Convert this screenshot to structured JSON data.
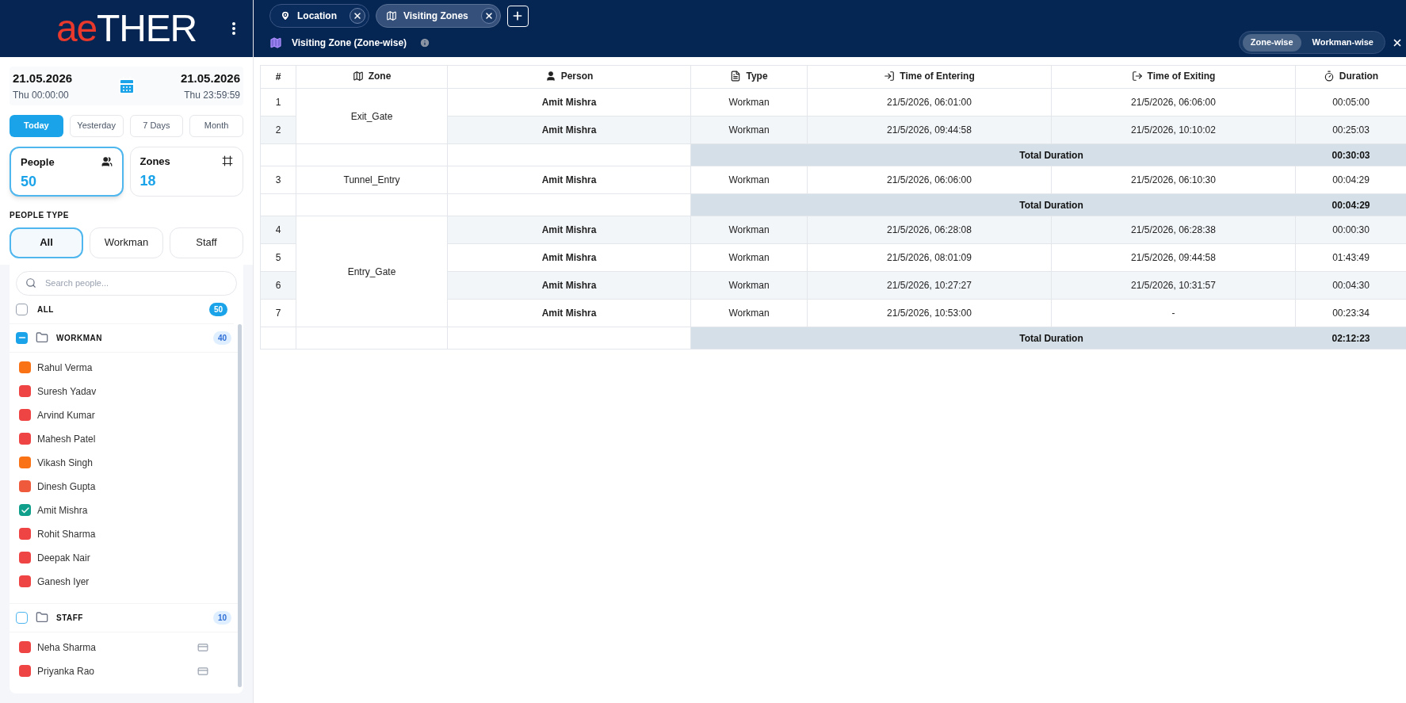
{
  "logo": {
    "accent": "ae",
    "rest": "THER"
  },
  "date_range": {
    "start_date": "21.05.2026",
    "start_time": "Thu 00:00:00",
    "end_date": "21.05.2026",
    "end_time": "Thu 23:59:59"
  },
  "range_buttons": [
    {
      "label": "Today",
      "selected": true
    },
    {
      "label": "Yesterday",
      "selected": false
    },
    {
      "label": "7 Days",
      "selected": false
    },
    {
      "label": "Month",
      "selected": false
    }
  ],
  "stat_cards": [
    {
      "kind": "people",
      "label": "People",
      "value": "50",
      "selected": true
    },
    {
      "kind": "zones",
      "label": "Zones",
      "value": "18",
      "selected": false
    }
  ],
  "people_type": {
    "title": "PEOPLE TYPE",
    "options": [
      {
        "label": "All",
        "selected": true
      },
      {
        "label": "Workman",
        "selected": false
      },
      {
        "label": "Staff",
        "selected": false
      }
    ]
  },
  "search": {
    "placeholder": "Search people..."
  },
  "all_row": {
    "label": "ALL",
    "count": "50",
    "checked": false
  },
  "groups": [
    {
      "label": "WORKMAN",
      "count": "40",
      "indeterminate": true,
      "people": [
        {
          "name": "Rahul Verma",
          "color": "#f97316",
          "checked": false,
          "kind": "plain"
        },
        {
          "name": "Suresh Yadav",
          "color": "#ef4444",
          "checked": false,
          "kind": "plain"
        },
        {
          "name": "Arvind Kumar",
          "color": "#ef4444",
          "checked": false,
          "kind": "plain"
        },
        {
          "name": "Mahesh Patel",
          "color": "#ef4444",
          "checked": false,
          "kind": "plain"
        },
        {
          "name": "Vikash Singh",
          "color": "#f97316",
          "checked": false,
          "kind": "plain"
        },
        {
          "name": "Dinesh Gupta",
          "color": "#f05a3c",
          "checked": false,
          "kind": "plain"
        },
        {
          "name": "Amit Mishra",
          "color": "#0f9f8a",
          "checked": true,
          "kind": "plain"
        },
        {
          "name": "Rohit Sharma",
          "color": "#ef4444",
          "checked": false,
          "kind": "plain"
        },
        {
          "name": "Deepak Nair",
          "color": "#ef4444",
          "checked": false,
          "kind": "plain"
        },
        {
          "name": "Ganesh Iyer",
          "color": "#ef4444",
          "checked": false,
          "kind": "plain"
        }
      ]
    },
    {
      "label": "STAFF",
      "count": "10",
      "indeterminate": false,
      "people": [
        {
          "name": "Neha Sharma",
          "color": "#ef4444",
          "checked": false,
          "kind": "card"
        },
        {
          "name": "Priyanka Rao",
          "color": "#ef4444",
          "checked": false,
          "kind": "card"
        }
      ]
    }
  ],
  "tabs": [
    {
      "label": "Location",
      "kind": "pin",
      "selected": false
    },
    {
      "label": "Visiting Zones",
      "kind": "map",
      "selected": true
    }
  ],
  "report_title": "Visiting Zone (Zone-wise)",
  "view_toggle": [
    {
      "label": "Zone-wise",
      "selected": true
    },
    {
      "label": "Workman-wise",
      "selected": false
    }
  ],
  "table": {
    "columns": [
      {
        "label": "#",
        "kind": "none"
      },
      {
        "label": "Zone",
        "kind": "map"
      },
      {
        "label": "Person",
        "kind": "user"
      },
      {
        "label": "Type",
        "kind": "doc"
      },
      {
        "label": "Time of Entering",
        "kind": "enter"
      },
      {
        "label": "Time of Exiting",
        "kind": "exit"
      },
      {
        "label": "Duration",
        "kind": "timer"
      }
    ],
    "groups": [
      {
        "zone": "Exit_Gate",
        "total_label": "Total Duration",
        "total": "00:30:03",
        "rows": [
          {
            "index": "1",
            "person": "Amit Mishra",
            "type": "Workman",
            "entered": "21/5/2026, 06:01:00",
            "exited": "21/5/2026, 06:06:00",
            "duration": "00:05:00"
          },
          {
            "index": "2",
            "person": "Amit Mishra",
            "type": "Workman",
            "entered": "21/5/2026, 09:44:58",
            "exited": "21/5/2026, 10:10:02",
            "duration": "00:25:03"
          }
        ]
      },
      {
        "zone": "Tunnel_Entry",
        "total_label": "Total Duration",
        "total": "00:04:29",
        "rows": [
          {
            "index": "3",
            "person": "Amit Mishra",
            "type": "Workman",
            "entered": "21/5/2026, 06:06:00",
            "exited": "21/5/2026, 06:10:30",
            "duration": "00:04:29"
          }
        ]
      },
      {
        "zone": "Entry_Gate",
        "total_label": "Total Duration",
        "total": "02:12:23",
        "rows": [
          {
            "index": "4",
            "person": "Amit Mishra",
            "type": "Workman",
            "entered": "21/5/2026, 06:28:08",
            "exited": "21/5/2026, 06:28:38",
            "duration": "00:00:30"
          },
          {
            "index": "5",
            "person": "Amit Mishra",
            "type": "Workman",
            "entered": "21/5/2026, 08:01:09",
            "exited": "21/5/2026, 09:44:58",
            "duration": "01:43:49"
          },
          {
            "index": "6",
            "person": "Amit Mishra",
            "type": "Workman",
            "entered": "21/5/2026, 10:27:27",
            "exited": "21/5/2026, 10:31:57",
            "duration": "00:04:30"
          },
          {
            "index": "7",
            "person": "Amit Mishra",
            "type": "Workman",
            "entered": "21/5/2026, 10:53:00",
            "exited": "-",
            "duration": "00:23:34"
          }
        ]
      }
    ]
  }
}
